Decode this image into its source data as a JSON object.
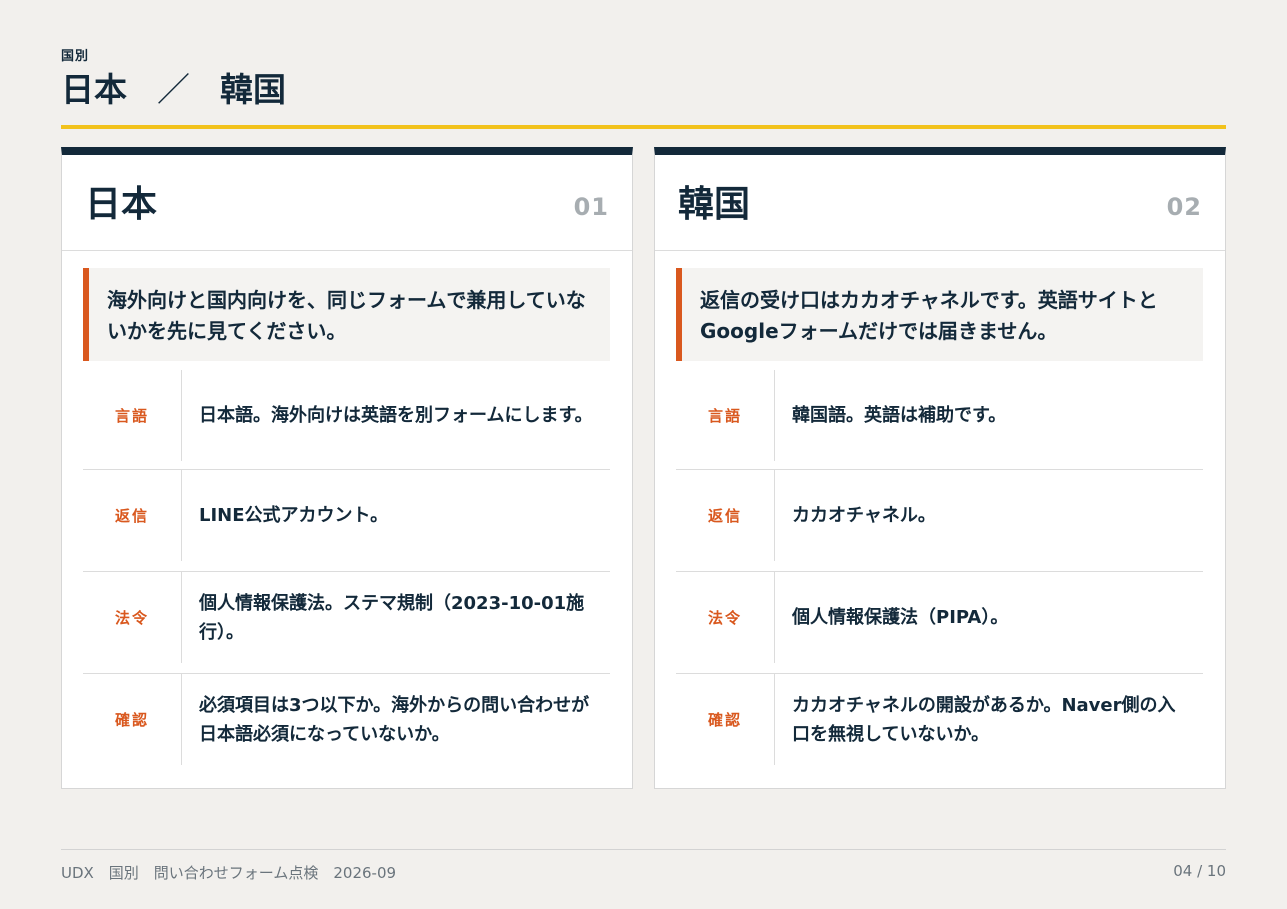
{
  "header": {
    "kicker": "国別",
    "title_left": "日本",
    "title_sep": "／",
    "title_right": "韓国"
  },
  "cards": [
    {
      "name": "日本",
      "number": "01",
      "callout": "海外向けと国内向けを、同じフォームで兼用していないかを先に見てください。",
      "rows": [
        {
          "label": "言語",
          "value": "日本語。海外向けは英語を別フォームにします。"
        },
        {
          "label": "返信",
          "value": "LINE公式アカウント。"
        },
        {
          "label": "法令",
          "value": "個人情報保護法。ステマ規制（2023-10-01施行）。"
        },
        {
          "label": "確認",
          "value": "必須項目は3つ以下か。海外からの問い合わせが日本語必須になっていないか。"
        }
      ]
    },
    {
      "name": "韓国",
      "number": "02",
      "callout": "返信の受け口はカカオチャネルです。英語サイトとGoogleフォームだけでは届きません。",
      "rows": [
        {
          "label": "言語",
          "value": "韓国語。英語は補助です。"
        },
        {
          "label": "返信",
          "value": "カカオチャネル。"
        },
        {
          "label": "法令",
          "value": "個人情報保護法（PIPA）。"
        },
        {
          "label": "確認",
          "value": "カカオチャネルの開設があるか。Naver側の入口を無視していないか。"
        }
      ]
    }
  ],
  "footer": {
    "left": "UDX　国別　問い合わせフォーム点検　2026-09",
    "page": "04 / 10"
  },
  "colors": {
    "navy": "#13293a",
    "accent_yellow": "#f2c21b",
    "accent_orange": "#d9581e",
    "background": "#f2f0ed"
  }
}
